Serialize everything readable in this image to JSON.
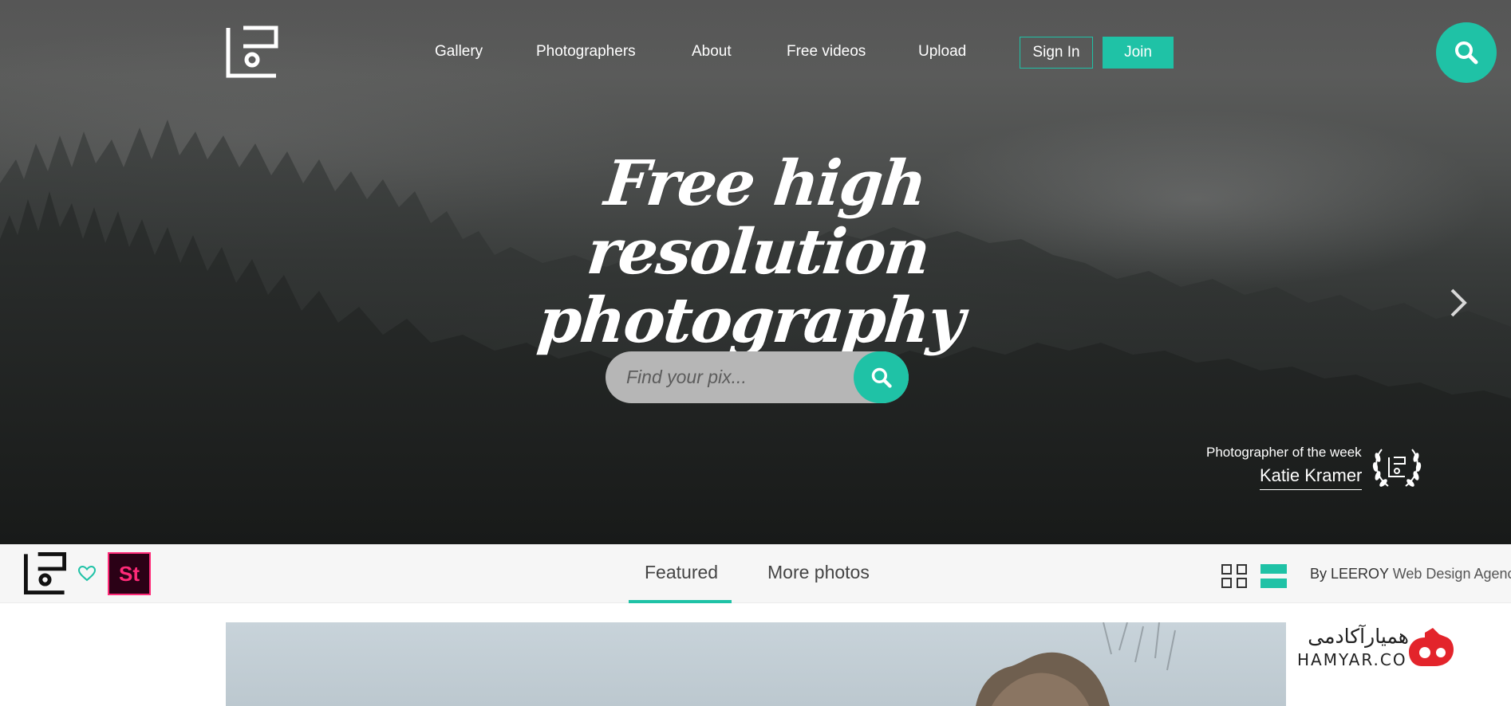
{
  "nav": {
    "items": [
      "Gallery",
      "Photographers",
      "About",
      "Free videos",
      "Upload"
    ],
    "sign_in": "Sign In",
    "join": "Join"
  },
  "hero": {
    "headline_line1": "Free high resolution",
    "headline_line2": "photography",
    "search_placeholder": "Find your pix...",
    "photographer_label": "Photographer of the week",
    "photographer_name": "Katie Kramer"
  },
  "toolbar": {
    "stock_badge": "St",
    "tabs": [
      "Featured",
      "More photos"
    ],
    "active_tab": "Featured",
    "byline_prefix": "By LEEROY",
    "byline_agency": "Web Design Agency"
  },
  "watermark": {
    "persian": "همیارآکادمی",
    "latin": "HAMYAR.CO"
  },
  "colors": {
    "accent": "#1fc2a6",
    "stock_pink": "#ff2a78",
    "stock_bg": "#2b0116",
    "hamyar_red": "#e3242b"
  },
  "icons": {
    "search": "magnifier-icon",
    "next": "chevron-right-icon",
    "heart": "heart-outline-icon",
    "grid": "grid-view-icon",
    "list": "list-view-icon",
    "badge": "laurel-badge-icon"
  }
}
